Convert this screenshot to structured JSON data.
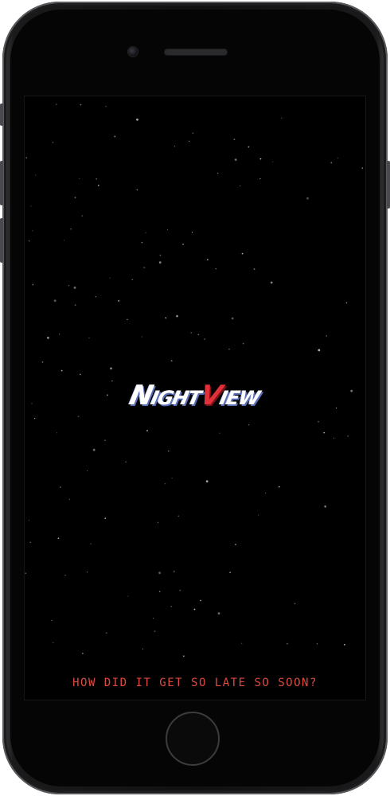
{
  "app": {
    "logo": {
      "part1_initial": "N",
      "part1_rest": "IGHT",
      "part2": "V",
      "part3": "IEW"
    },
    "tagline": "HOW DID IT GET SO LATE SO SOON?"
  },
  "colors": {
    "background": "#000000",
    "logo_white": "#ffffff",
    "logo_accent_red": "#e0313a",
    "logo_shadow_blue": "#5b6fb8",
    "tagline": "#e0493f",
    "star": "#c8c8d0"
  },
  "device": {
    "type": "phone",
    "icons": [
      "front-camera-icon",
      "earpiece-speaker-icon",
      "home-button-icon"
    ]
  }
}
